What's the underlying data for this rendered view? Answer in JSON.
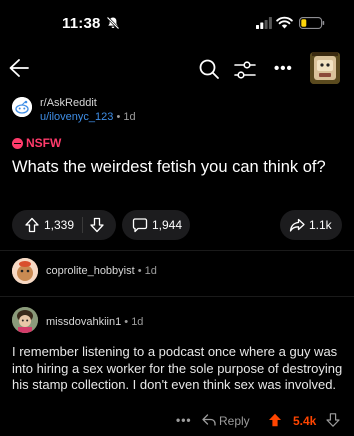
{
  "status_bar": {
    "time": "11:38"
  },
  "nav": {},
  "post": {
    "subreddit": "r/AskReddit",
    "author": "u/ilovenyc_123",
    "age": "1d",
    "nsfw_label": "NSFW",
    "title": "Whats the weirdest fetish you can think of?",
    "upvotes": "1,339",
    "comments": "1,944",
    "shares": "1.1k"
  },
  "comments": [
    {
      "author": "coprolite_hobbyist",
      "age": "1d"
    },
    {
      "author": "missdovahkiin1",
      "age": "1d",
      "body": "I remember listening to a podcast once where a guy was into hiring a sex worker for the sole purpose of destroying his stamp collection. I don't even think sex was involved.",
      "reply_label": "Reply",
      "score": "5.4k"
    }
  ],
  "colors": {
    "accent_upvote": "#ff4500",
    "nsfw": "#ff3b6b",
    "link": "#3f8ee6"
  }
}
